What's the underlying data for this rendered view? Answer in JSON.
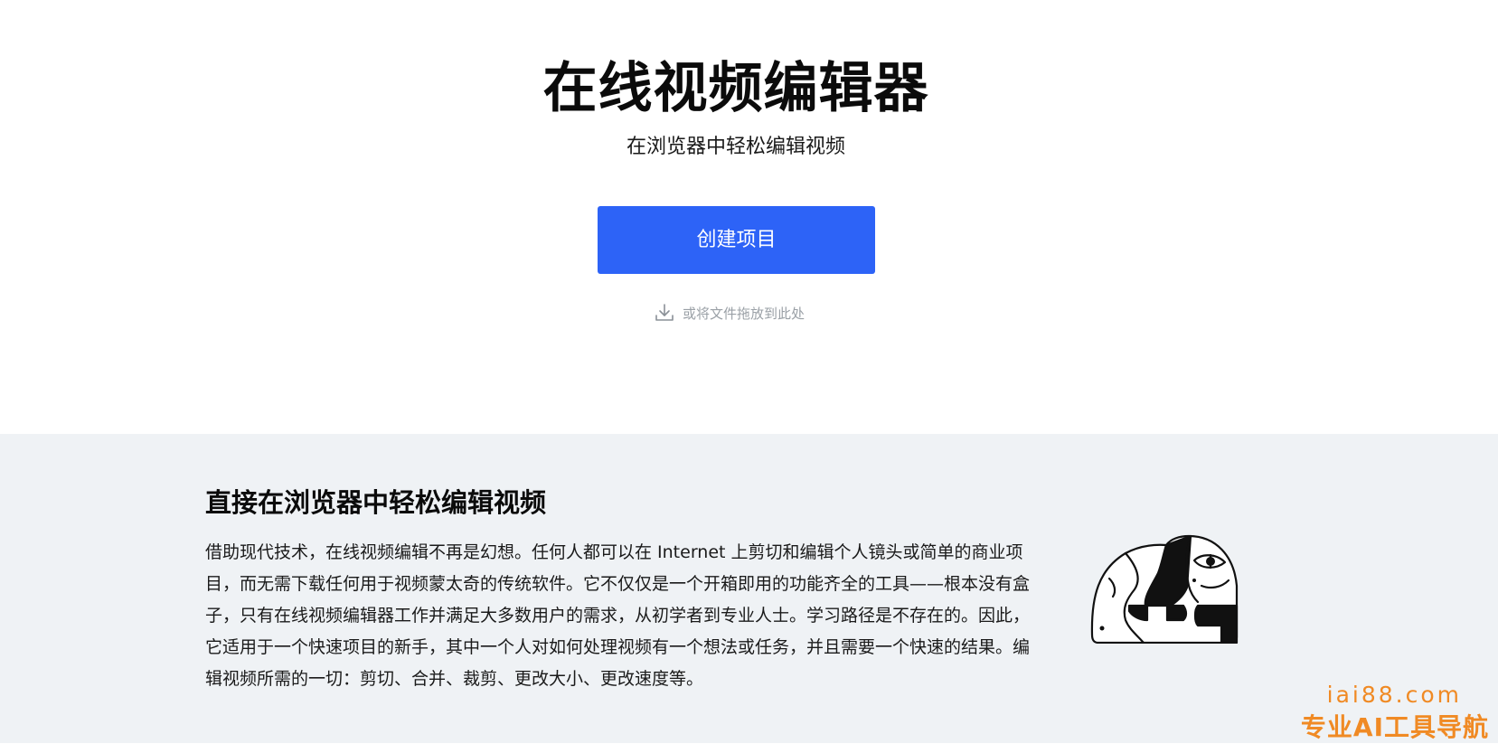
{
  "hero": {
    "title": "在线视频编辑器",
    "subtitle": "在浏览器中轻松编辑视频",
    "create_button_label": "创建项目",
    "drop_hint": "或将文件拖放到此处",
    "drop_icon": "download-icon"
  },
  "info": {
    "title": "直接在浏览器中轻松编辑视频",
    "body": "借助现代技术，在线视频编辑不再是幻想。任何人都可以在 Internet 上剪切和编辑个人镜头或简单的商业项目，而无需下载任何用于视频蒙太奇的传统软件。它不仅仅是一个开箱即用的功能齐全的工具——根本没有盒子，只有在线视频编辑器工作并满足大多数用户的需求，从初学者到专业人士。学习路径是不存在的。因此，它适用于一个快速项目的新手，其中一个人对如何处理视频有一个想法或任务，并且需要一个快速的结果。编辑视频所需的一切：剪切、合并、裁剪、更改大小、更改速度等。",
    "illustration": "abstract-face-illustration"
  },
  "watermark": {
    "domain": "iai88.com",
    "tagline": "专业AI工具导航"
  },
  "colors": {
    "accent": "#2d63f7",
    "section_bg": "#eff2f5",
    "hint_text": "#9aa0a6",
    "watermark": "#f08a24"
  }
}
